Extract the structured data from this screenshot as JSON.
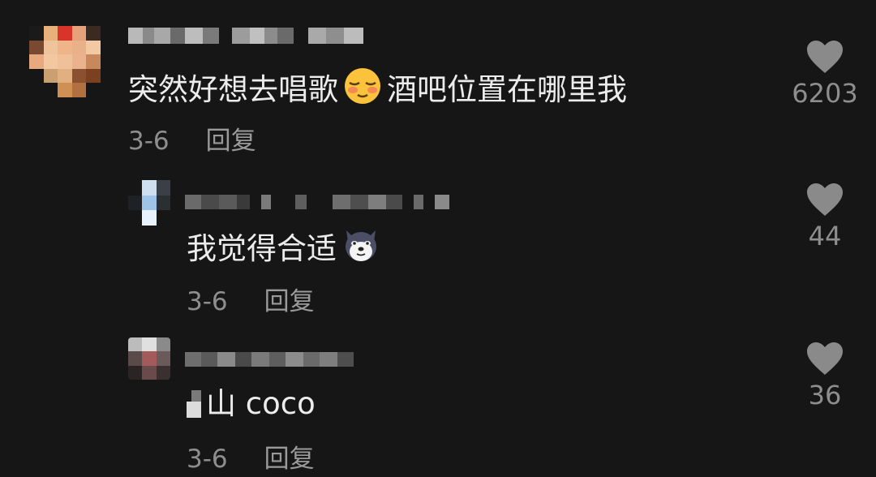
{
  "comments": [
    {
      "text_before": "突然好想去唱歌",
      "emoji": "blushing-smile-emoji",
      "text_after": "酒吧位置在哪里我",
      "date": "3-6",
      "reply_label": "回复",
      "likes": "6203"
    },
    {
      "text_before": "我觉得合适",
      "emoji": "dog-face-emoji",
      "text_after": "",
      "date": "3-6",
      "reply_label": "回复",
      "likes": "44"
    },
    {
      "text_before": "山 coco",
      "emoji": "",
      "text_after": "",
      "date": "3-6",
      "reply_label": "回复",
      "likes": "36"
    }
  ],
  "colors": {
    "background": "#161616",
    "text": "#ececec",
    "muted": "#8e8e8e",
    "heart": "#8a8a8a"
  }
}
